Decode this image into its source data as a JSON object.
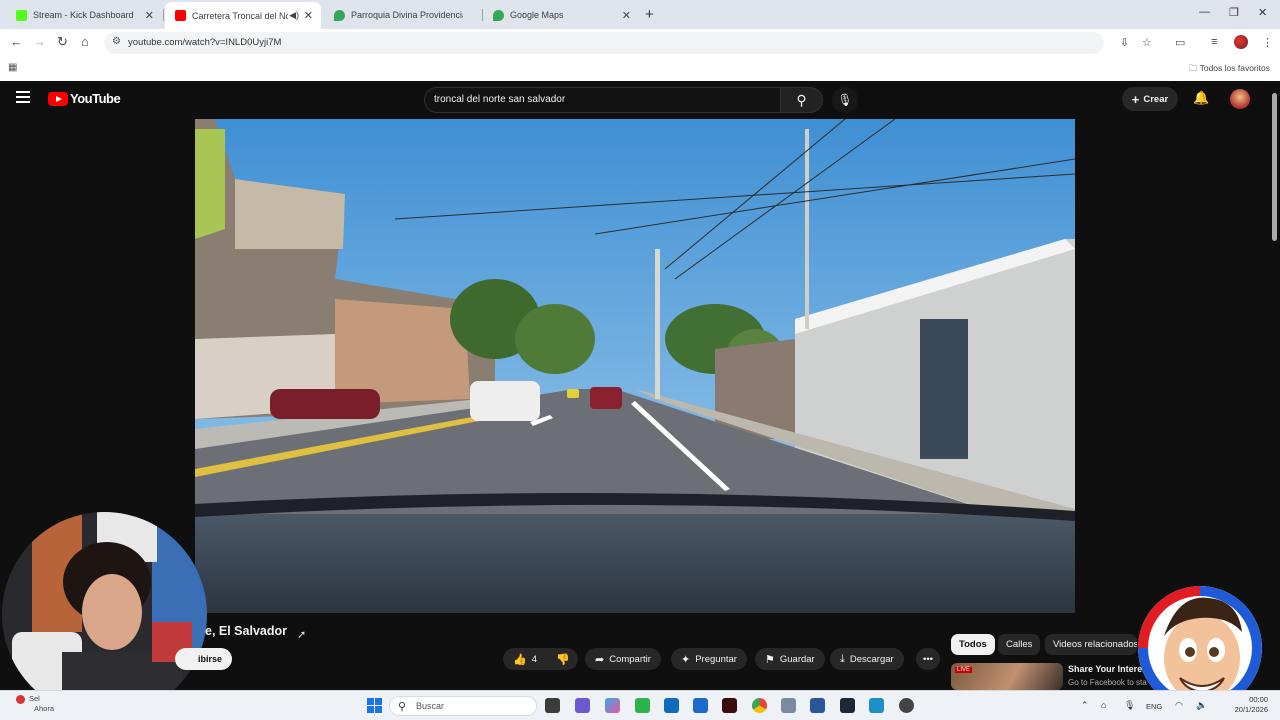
{
  "browser": {
    "tabs": [
      {
        "title": "Stream - Kick Dashboard",
        "favicon_color": "#53fc18"
      },
      {
        "title": "Carretera Troncal del Norte",
        "favicon_color": "#ff0000"
      },
      {
        "title": "Parroquia Divina Providencia - ",
        "favicon_color": "#34a853"
      },
      {
        "title": "Google Maps",
        "favicon_color": "#34a853"
      }
    ],
    "close_glyph": "✕",
    "new_tab_glyph": "+",
    "url": "youtube.com/watch?v=INLD0Uyji7M",
    "bookmarks_folder": "Todos los favoritos"
  },
  "youtube": {
    "logo_text": "YouTube",
    "search_value": "troncal del norte san salvador",
    "create_label": "Crear",
    "video_title_visible": "e, El Salvador",
    "subscribe_label": "ibirse",
    "like_count": "4",
    "actions": {
      "share": "Compartir",
      "ask": "Preguntar",
      "save": "Guardar",
      "download": "Descargar"
    },
    "chips": [
      "Todos",
      "Calles",
      "Videos relacionados"
    ],
    "recommendation": {
      "title": "Share Your Intere",
      "subtitle": "Go to Facebook to sta",
      "badge": "LIVE"
    }
  },
  "taskbar": {
    "search_placeholder": "Buscar",
    "notification_title": "Sel",
    "notification_time": "Ahora",
    "language": "ENG",
    "time": "00:00",
    "date": "20/1/2026"
  },
  "colors": {
    "youtube_red": "#ff0000",
    "page_bg": "#0f0f0f",
    "chip_selected": "#f1f1f1"
  }
}
